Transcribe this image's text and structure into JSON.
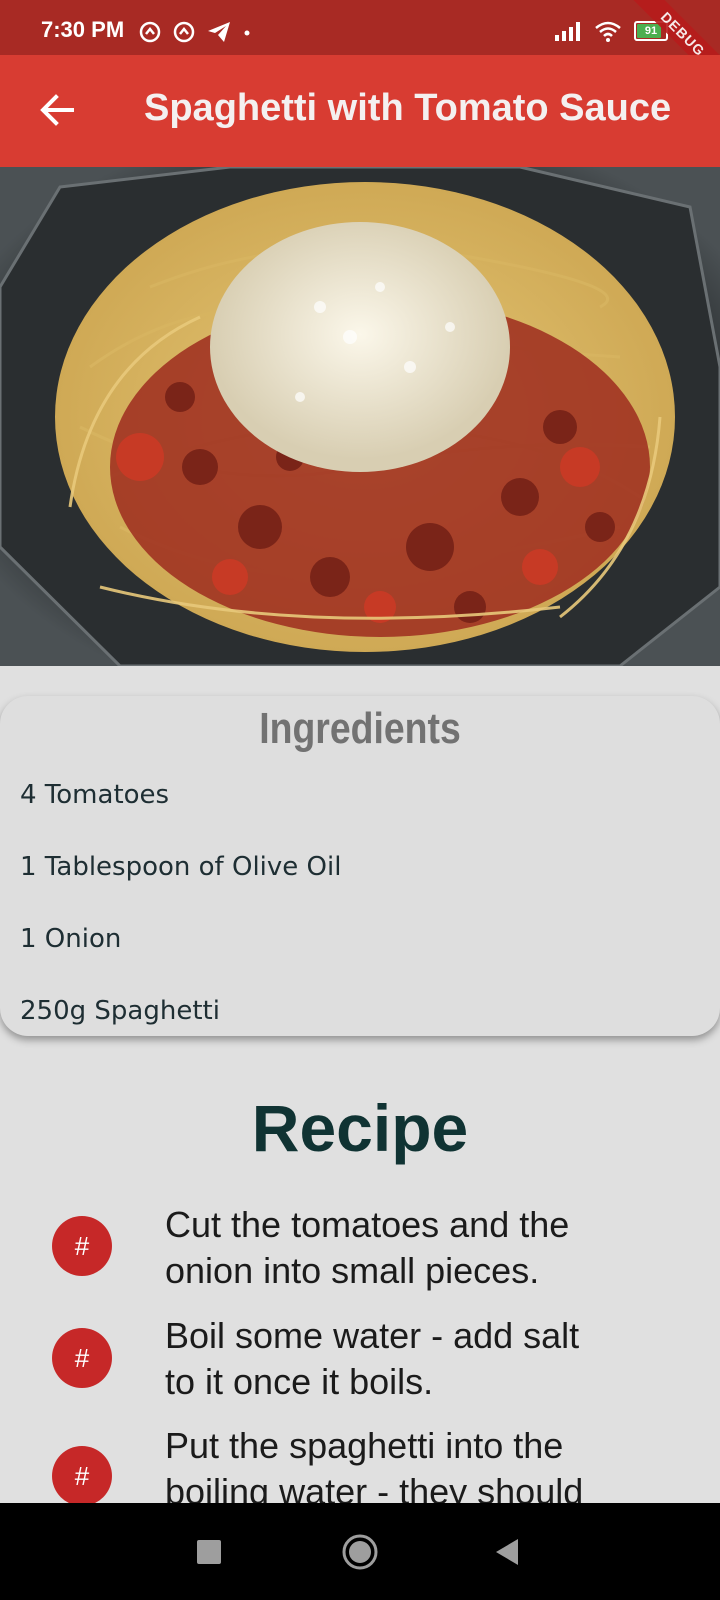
{
  "status_bar": {
    "time": "7:30 PM",
    "battery_level": "91",
    "debug_label": "DEBUG"
  },
  "app_bar": {
    "title": "Spaghetti with Tomato Sauce",
    "back_icon": "arrow-back-icon"
  },
  "hero_image": {
    "subject": "spaghetti with tomato sauce and grated cheese"
  },
  "ingredients": {
    "title": "Ingredients",
    "items": [
      "4 Tomatoes",
      "1 Tablespoon of Olive Oil",
      "1 Onion",
      "250g Spaghetti"
    ]
  },
  "recipe": {
    "title": "Recipe",
    "badge_label": "#",
    "steps": [
      {
        "line1": "Cut the tomatoes and the",
        "line2": "onion into small pieces."
      },
      {
        "line1": "Boil some water - add salt",
        "line2": "to it once it boils."
      },
      {
        "line1": "Put the spaghetti into the",
        "line2": "boiling water - they should"
      }
    ]
  },
  "colors": {
    "status_bar": "#a82a24",
    "app_bar": "#d83c32",
    "badge": "#c62828",
    "background": "#e0e0e0"
  }
}
